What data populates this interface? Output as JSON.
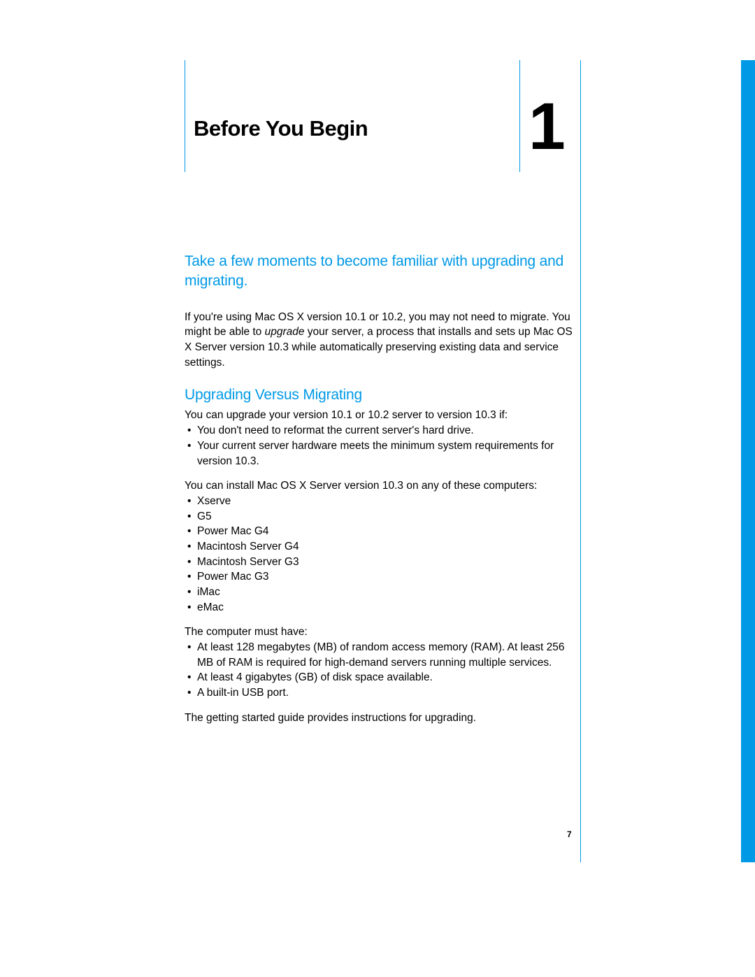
{
  "chapter": {
    "title": "Before You Begin",
    "number": "1"
  },
  "intro": {
    "subtitle": "Take a few moments to become familiar with upgrading and migrating.",
    "para_pre": "If you're using Mac OS X version 10.1 or 10.2, you may not need to migrate. You might be able to ",
    "para_em": "upgrade",
    "para_post": " your server, a process that installs and sets up Mac OS X Server version 10.3 while automatically preserving existing data and service settings."
  },
  "section": {
    "heading": "Upgrading Versus Migrating",
    "upgrade_if_line": "You can upgrade your version 10.1 or 10.2 server to version 10.3 if:",
    "upgrade_if_bullets": [
      "You don't need to reformat the current server's hard drive.",
      "Your current server hardware meets the minimum system requirements for version 10.3."
    ],
    "installable_line": "You can install Mac OS X Server version 10.3 on any of these computers:",
    "installable_bullets": [
      "Xserve",
      "G5",
      "Power Mac G4",
      "Macintosh Server G4",
      "Macintosh Server G3",
      "Power Mac G3",
      "iMac",
      "eMac"
    ],
    "must_have_line": "The computer must have:",
    "must_have_bullets": [
      "At least 128 megabytes (MB) of random access memory (RAM). At least 256 MB of RAM is required for high-demand servers running multiple services.",
      "At least 4 gigabytes (GB) of disk space available.",
      "A built-in USB port."
    ],
    "closing_line": "The getting started guide provides instructions for upgrading."
  },
  "page_number": "7",
  "colors": {
    "accent": "#0099e6"
  }
}
